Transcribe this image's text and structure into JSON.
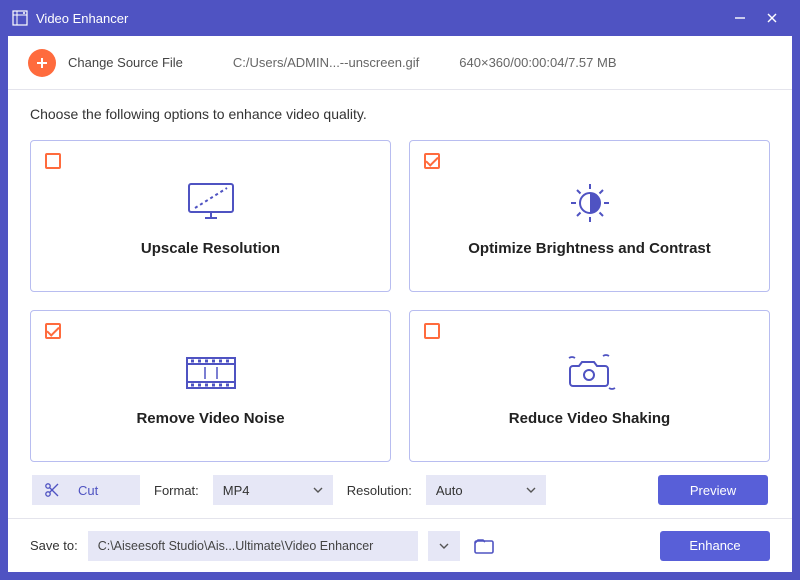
{
  "window": {
    "title": "Video Enhancer"
  },
  "source": {
    "change_label": "Change Source File",
    "path": "C:/Users/ADMIN...--unscreen.gif",
    "meta": "640×360/00:00:04/7.57 MB"
  },
  "prompt": "Choose the following options to enhance video quality.",
  "cards": [
    {
      "title": "Upscale Resolution",
      "checked": false
    },
    {
      "title": "Optimize Brightness and Contrast",
      "checked": true
    },
    {
      "title": "Remove Video Noise",
      "checked": true
    },
    {
      "title": "Reduce Video Shaking",
      "checked": false
    }
  ],
  "toolbar": {
    "cut_label": "Cut",
    "format_label": "Format:",
    "format_value": "MP4",
    "resolution_label": "Resolution:",
    "resolution_value": "Auto",
    "preview_label": "Preview"
  },
  "footer": {
    "save_label": "Save to:",
    "save_path": "C:\\Aiseesoft Studio\\Ais...Ultimate\\Video Enhancer",
    "enhance_label": "Enhance"
  }
}
